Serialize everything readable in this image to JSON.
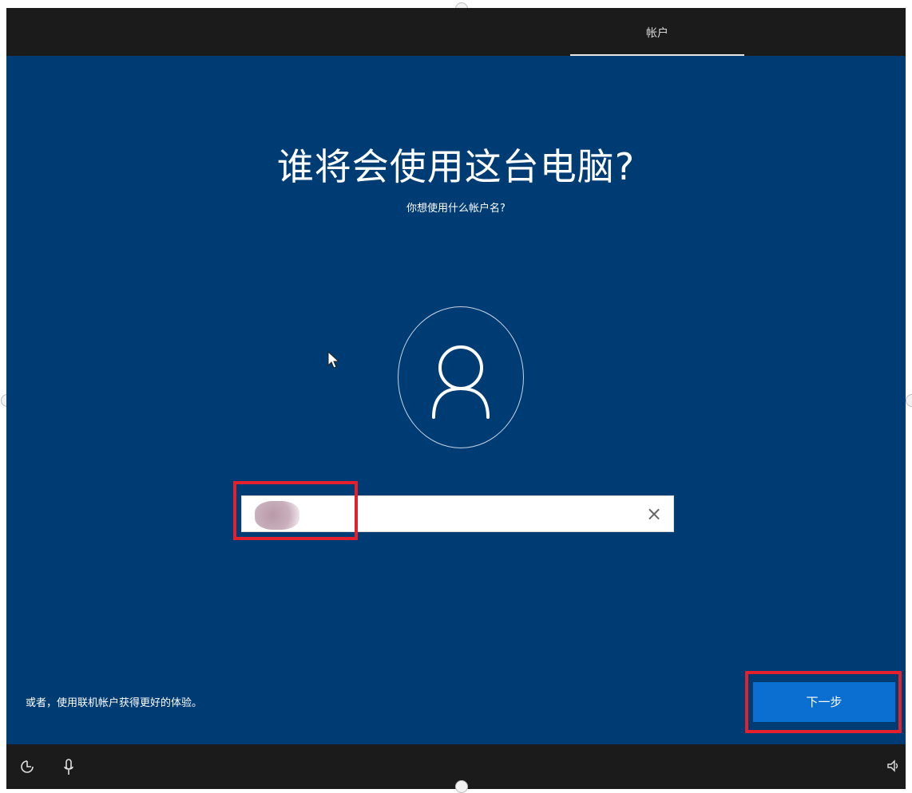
{
  "header": {
    "tab_label": "帐户"
  },
  "main": {
    "title": "谁将会使用这台电脑?",
    "subtitle": "你想使用什么帐户名?",
    "username_value": ""
  },
  "footer": {
    "alt_link": "或者，使用联机帐户获得更好的体验。",
    "next_label": "下一步"
  },
  "taskbar": {
    "left_icons": [
      "accessibility-icon",
      "microphone-icon"
    ],
    "right_icons": [
      "volume-icon"
    ]
  },
  "colors": {
    "background": "#003c74",
    "top_bar": "#1b1b1b",
    "next_button": "#0a6fd1",
    "highlight": "#e3202b"
  }
}
